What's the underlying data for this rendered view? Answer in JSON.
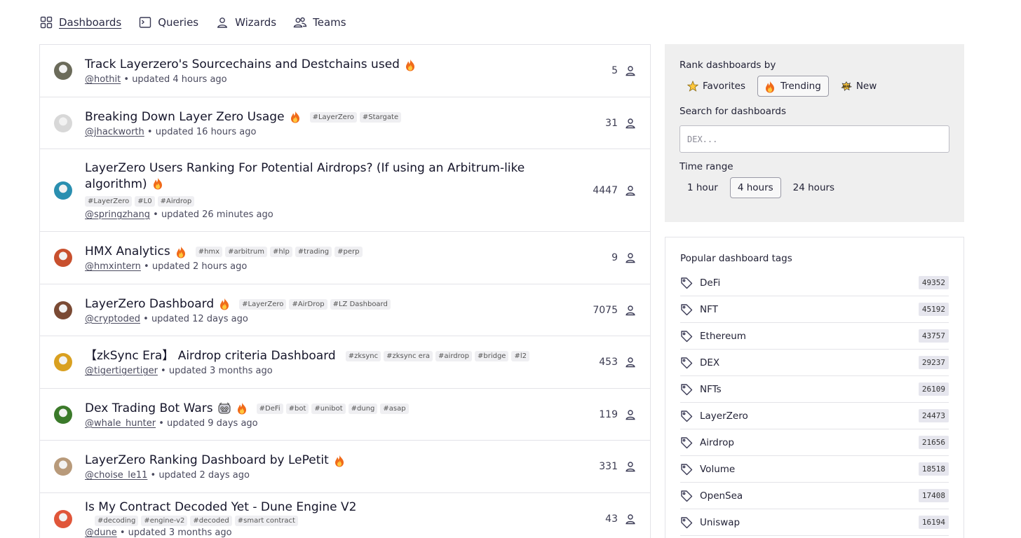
{
  "nav": [
    {
      "label": "Dashboards",
      "icon": "grid-icon",
      "active": true
    },
    {
      "label": "Queries",
      "icon": "terminal-icon",
      "active": false
    },
    {
      "label": "Wizards",
      "icon": "user-icon",
      "active": false
    },
    {
      "label": "Teams",
      "icon": "users-icon",
      "active": false
    }
  ],
  "dashboards": [
    {
      "title": "Track Layerzero's Sourcechains and Destchains used",
      "fire": true,
      "tags": [],
      "user": "@hothit",
      "updated": "updated 4 hours ago",
      "stars": "5",
      "avatar_color": "#6b6b5a"
    },
    {
      "title": "Breaking Down Layer Zero Usage",
      "fire": true,
      "tags": [
        "#LayerZero",
        "#Stargate"
      ],
      "user": "@jhackworth",
      "updated": "updated 16 hours ago",
      "stars": "31",
      "avatar_color": "#d8d8d8"
    },
    {
      "title": "LayerZero Users Ranking For Potential Airdrops? (If using an Arbitrum-like algorithm)",
      "fire": true,
      "tags": [
        "#LayerZero",
        "#L0",
        "#Airdrop"
      ],
      "user": "@springzhang",
      "updated": "updated 26 minutes ago",
      "stars": "4447",
      "avatar_color": "#2a8fb0"
    },
    {
      "title": "HMX Analytics",
      "fire": true,
      "tags": [
        "#hmx",
        "#arbitrum",
        "#hlp",
        "#trading",
        "#perp"
      ],
      "user": "@hmxintern",
      "updated": "updated 2 hours ago",
      "stars": "9",
      "avatar_color": "#c8502e"
    },
    {
      "title": "LayerZero Dashboard",
      "fire": true,
      "tags": [
        "#LayerZero",
        "#AirDrop",
        "#LZ Dashboard"
      ],
      "user": "@cryptoded",
      "updated": "updated 12 days ago",
      "stars": "7075",
      "avatar_color": "#7a4a34"
    },
    {
      "title": "【zkSync Era】 Airdrop criteria Dashboard",
      "fire": false,
      "tags": [
        "#zksync",
        "#zksync era",
        "#airdrop",
        "#bridge",
        "#l2"
      ],
      "user": "@tigertigertiger",
      "updated": "updated 3 months ago",
      "stars": "453",
      "avatar_color": "#d9a020"
    },
    {
      "title": "Dex Trading Bot Wars",
      "fire": true,
      "emoji": "robot-emoji-icon",
      "tags": [
        "#DeFi",
        "#bot",
        "#unibot",
        "#dung",
        "#asap"
      ],
      "user": "@whale_hunter",
      "updated": "updated 9 days ago",
      "stars": "119",
      "avatar_color": "#3b7a2a"
    },
    {
      "title": "LayerZero Ranking Dashboard by LePetit",
      "fire": true,
      "tags": [],
      "user": "@choise_le11",
      "updated": "updated 2 days ago",
      "stars": "331",
      "avatar_color": "#b89a7a"
    },
    {
      "title": "Is My Contract Decoded Yet - Dune Engine V2",
      "fire": false,
      "tags": [
        "#decoding",
        "#engine-v2",
        "#decoded",
        "#smart contract"
      ],
      "user": "@dune",
      "updated": "updated 3 months ago",
      "stars": "43",
      "avatar_color": "#e0563a"
    }
  ],
  "rank": {
    "heading": "Rank dashboards by",
    "options": [
      {
        "label": "Favorites",
        "icon": "star-icon",
        "active": false
      },
      {
        "label": "Trending",
        "icon": "fire-icon",
        "active": true
      },
      {
        "label": "New",
        "icon": "new-icon",
        "active": false
      }
    ],
    "search_heading": "Search for dashboards",
    "search_placeholder": "DEX...",
    "time_heading": "Time range",
    "time_options": [
      {
        "label": "1 hour",
        "active": false
      },
      {
        "label": "4 hours",
        "active": true
      },
      {
        "label": "24 hours",
        "active": false
      }
    ]
  },
  "popular_tags": {
    "heading": "Popular dashboard tags",
    "items": [
      {
        "name": "DeFi",
        "count": "49352"
      },
      {
        "name": "NFT",
        "count": "45192"
      },
      {
        "name": "Ethereum",
        "count": "43757"
      },
      {
        "name": "DEX",
        "count": "29237"
      },
      {
        "name": "NFTs",
        "count": "26109"
      },
      {
        "name": "LayerZero",
        "count": "24473"
      },
      {
        "name": "Airdrop",
        "count": "21656"
      },
      {
        "name": "Volume",
        "count": "18518"
      },
      {
        "name": "OpenSea",
        "count": "17408"
      },
      {
        "name": "Uniswap",
        "count": "16194"
      }
    ]
  },
  "colors": {
    "fire": "#f06a1a",
    "fire_inner": "#ffc83d",
    "accent": "#6b6bd6"
  }
}
